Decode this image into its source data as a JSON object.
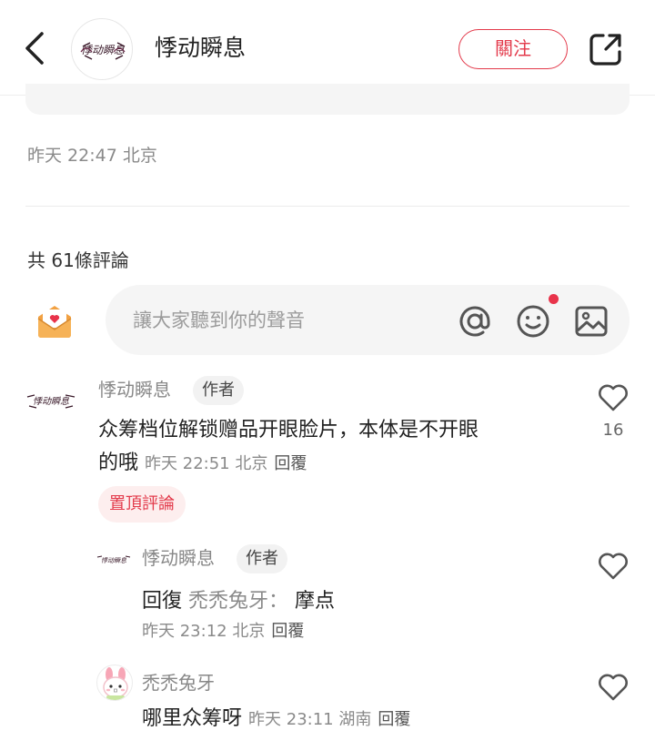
{
  "header": {
    "author_name": "悸动瞬息",
    "avatar_text": "悸动瞬息",
    "follow_label": "關注"
  },
  "post": {
    "timestamp": "昨天 22:47 北京"
  },
  "comments_summary": {
    "count_text": "共 61條評論"
  },
  "composer": {
    "placeholder": "讓大家聽到你的聲音"
  },
  "colors": {
    "accent": "#e33a4b",
    "pin_bg": "#fdeeee",
    "input_bg": "#f5f5f5"
  },
  "comments": [
    {
      "author": "悸动瞬息",
      "author_tag": "作者",
      "text_line1": "众筹档位解锁赠品开眼脸片，本体是不开眼",
      "text_line2": "的哦",
      "time": "昨天 22:51 北京",
      "reply_label": "回覆",
      "pinned_label": "置頂評論",
      "likes": "16"
    },
    {
      "author": "悸动瞬息",
      "author_tag": "作者",
      "prefix": "回復",
      "reply_to": "禿禿兔牙：",
      "text": "摩点",
      "time": "昨天 23:12 北京",
      "reply_label": "回覆"
    },
    {
      "author": "禿禿兔牙",
      "text": "哪里众筹呀",
      "time": "昨天 23:11 湖南",
      "reply_label": "回覆"
    }
  ]
}
